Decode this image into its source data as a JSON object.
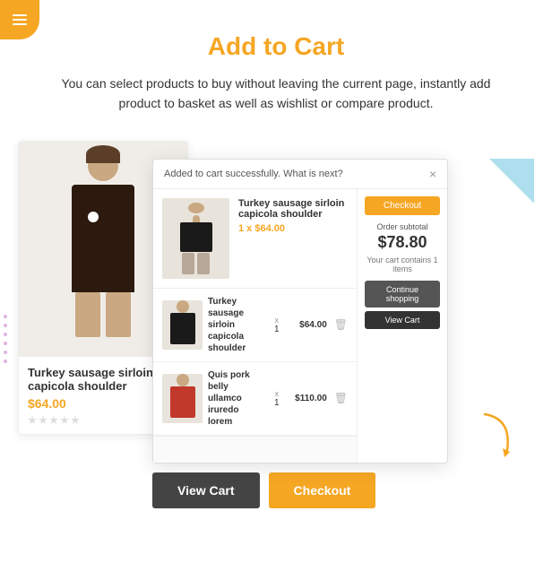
{
  "menu": {
    "label": "Menu"
  },
  "header": {
    "title": "Add to Cart",
    "description": "You can select products to buy without leaving the current page, instantly add product to basket as well as wishlist or compare product."
  },
  "product_card": {
    "name": "Turkey sausage sirloin capicola shoulder",
    "price": "$64.00",
    "stars": 5
  },
  "cart_popup": {
    "message": "Added to cart successfully. What is next?",
    "close": "×",
    "featured_product": {
      "name": "Turkey sausage sirloin capicola shoulder",
      "quantity_label": "1 x",
      "price": "$64.00"
    },
    "items": [
      {
        "name": "Turkey sausage sirloin capicola shoulder",
        "qty": "1",
        "price": "$64.00"
      },
      {
        "name": "Quis pork belly ullamco iruredo lorem",
        "qty": "1",
        "price": "$110.00"
      }
    ],
    "sidebar": {
      "checkout_label": "Checkout",
      "order_subtotal_label": "Order subtotal",
      "order_subtotal_amount": "$78.80",
      "cart_count_info": "Your cart contains 1 items",
      "continue_shopping_label": "Continue shopping",
      "view_cart_label": "View Cart"
    }
  },
  "buttons": {
    "view_cart": "View Cart",
    "checkout": "Checkout"
  }
}
